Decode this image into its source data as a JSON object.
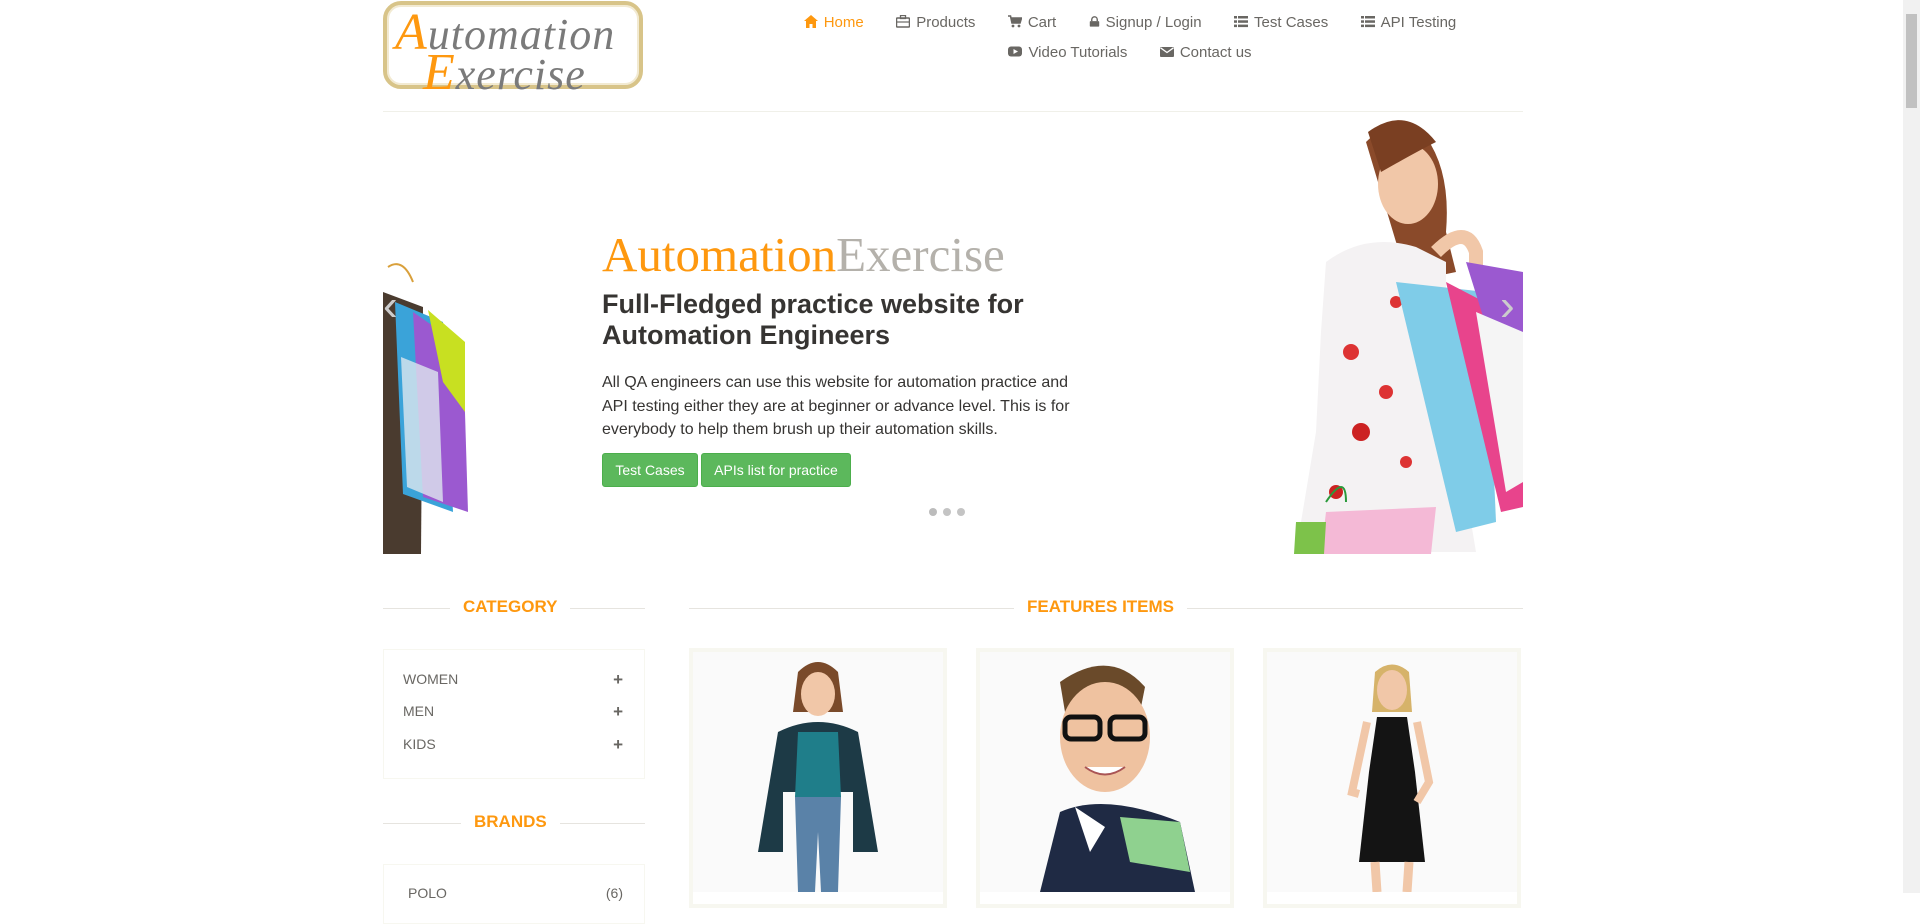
{
  "logo": {
    "line1_cap": "A",
    "line1_rest": "utomation",
    "line2_cap": "E",
    "line2_rest": "xercise"
  },
  "nav": [
    {
      "label": "Home",
      "icon": "home-icon",
      "active": true
    },
    {
      "label": "Products",
      "icon": "briefcase-icon"
    },
    {
      "label": "Cart",
      "icon": "cart-icon"
    },
    {
      "label": "Signup / Login",
      "icon": "lock-icon"
    },
    {
      "label": "Test Cases",
      "icon": "list-icon"
    },
    {
      "label": "API Testing",
      "icon": "list-icon"
    },
    {
      "label": "Video Tutorials",
      "icon": "youtube-icon"
    },
    {
      "label": "Contact us",
      "icon": "envelope-icon"
    }
  ],
  "slider": {
    "brand_orange": "Automation",
    "brand_grey": "Exercise",
    "heading": "Full-Fledged practice website for Automation Engineers",
    "text": "All QA engineers can use this website for automation practice and API testing either they are at beginner or advance level. This is for everybody to help them brush up their automation skills.",
    "btn_test_cases": "Test Cases",
    "btn_apis": "APIs list for practice",
    "prev_arrow": "‹",
    "next_arrow": "›"
  },
  "sidebar": {
    "category_title": "Category",
    "categories": [
      "WOMEN",
      "MEN",
      "KIDS"
    ],
    "brands_title": "Brands",
    "brands": [
      {
        "name": "POLO",
        "count": "(6)"
      }
    ]
  },
  "features": {
    "title": "Features Items"
  },
  "colors": {
    "accent": "#FE980F",
    "button": "#5CB85C",
    "text": "#696763"
  }
}
